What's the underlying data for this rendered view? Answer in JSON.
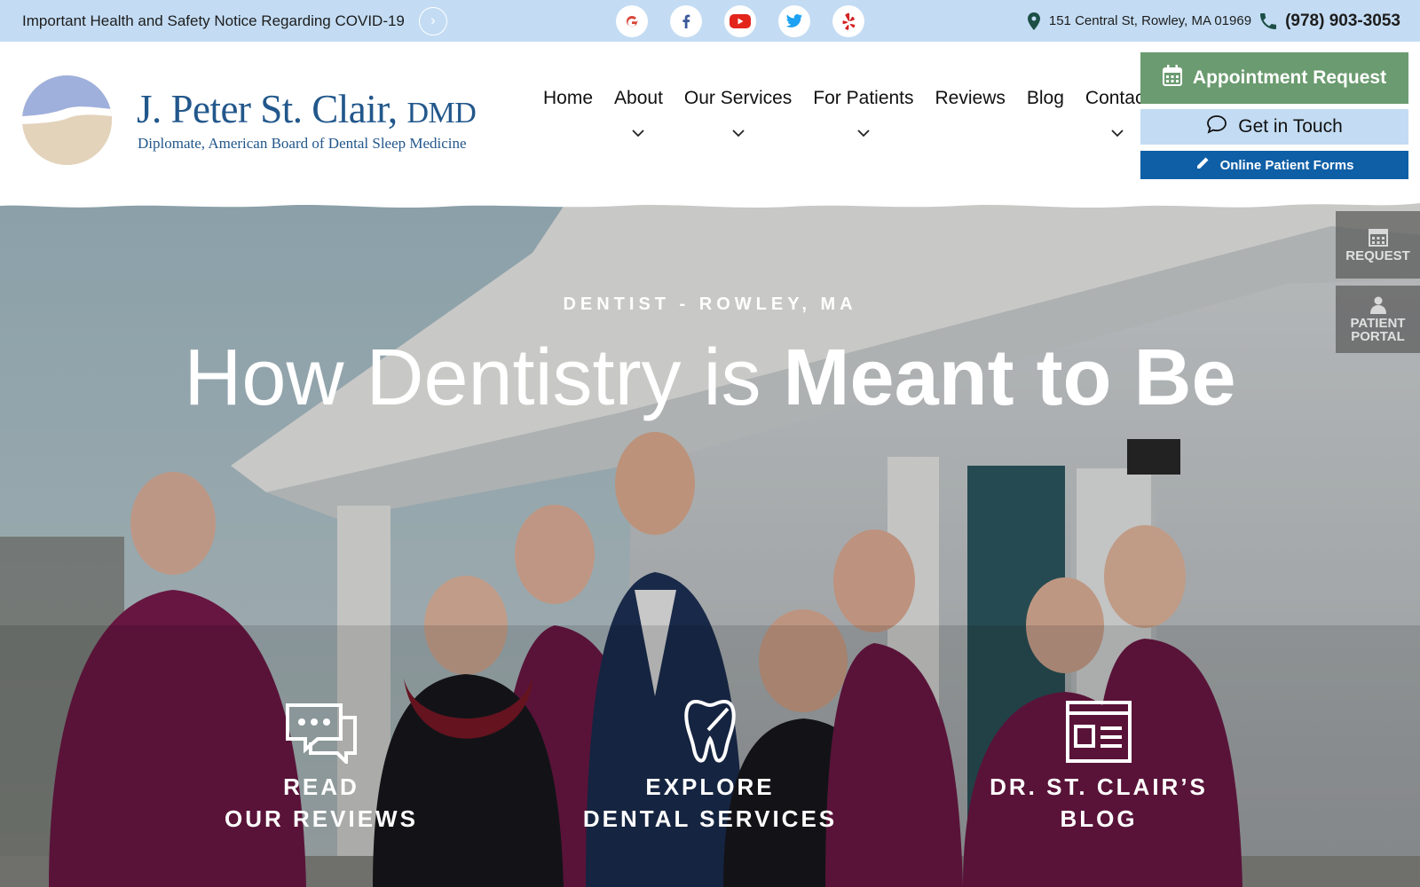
{
  "topbar": {
    "notice": "Important Health and Safety Notice Regarding COVID-19",
    "socials": [
      "google-icon",
      "facebook-icon",
      "youtube-icon",
      "twitter-icon",
      "yelp-icon"
    ],
    "address": "151 Central St, Rowley, MA 01969",
    "phone": "(978) 903-3053"
  },
  "logo": {
    "name": "J. Peter St. Clair,",
    "credential": "DMD",
    "subtitle": "Diplomate, American Board of Dental Sleep Medicine"
  },
  "nav": {
    "items": [
      {
        "label": "Home",
        "dropdown": false
      },
      {
        "label": "About",
        "dropdown": true
      },
      {
        "label": "Our Services",
        "dropdown": true
      },
      {
        "label": "For Patients",
        "dropdown": true
      },
      {
        "label": "Reviews",
        "dropdown": false
      },
      {
        "label": "Blog",
        "dropdown": false
      },
      {
        "label": "Contact",
        "dropdown": true
      }
    ]
  },
  "cta": {
    "appointment": "Appointment Request",
    "touch": "Get in Touch",
    "forms": "Online Patient Forms"
  },
  "hero": {
    "eyebrow": "DENTIST - ROWLEY, MA",
    "headline_light": "How Dentistry is ",
    "headline_bold": "Meant to Be",
    "features": [
      {
        "line1": "READ",
        "line2": "OUR REVIEWS",
        "icon": "chat-bubbles-icon"
      },
      {
        "line1": "EXPLORE",
        "line2": "DENTAL SERVICES",
        "icon": "tooth-icon"
      },
      {
        "line1": "DR. ST. CLAIR’S",
        "line2": "BLOG",
        "icon": "blog-window-icon"
      }
    ]
  },
  "side_tabs": {
    "request": "REQUEST",
    "portal_line1": "PATIENT",
    "portal_line2": "PORTAL"
  },
  "colors": {
    "topbar": "#c3dcf3",
    "brand_blue": "#22578b",
    "appointment_green": "#6b9b70",
    "forms_blue": "#0f5fa6",
    "scrub_maroon": "#7d1c4f"
  }
}
